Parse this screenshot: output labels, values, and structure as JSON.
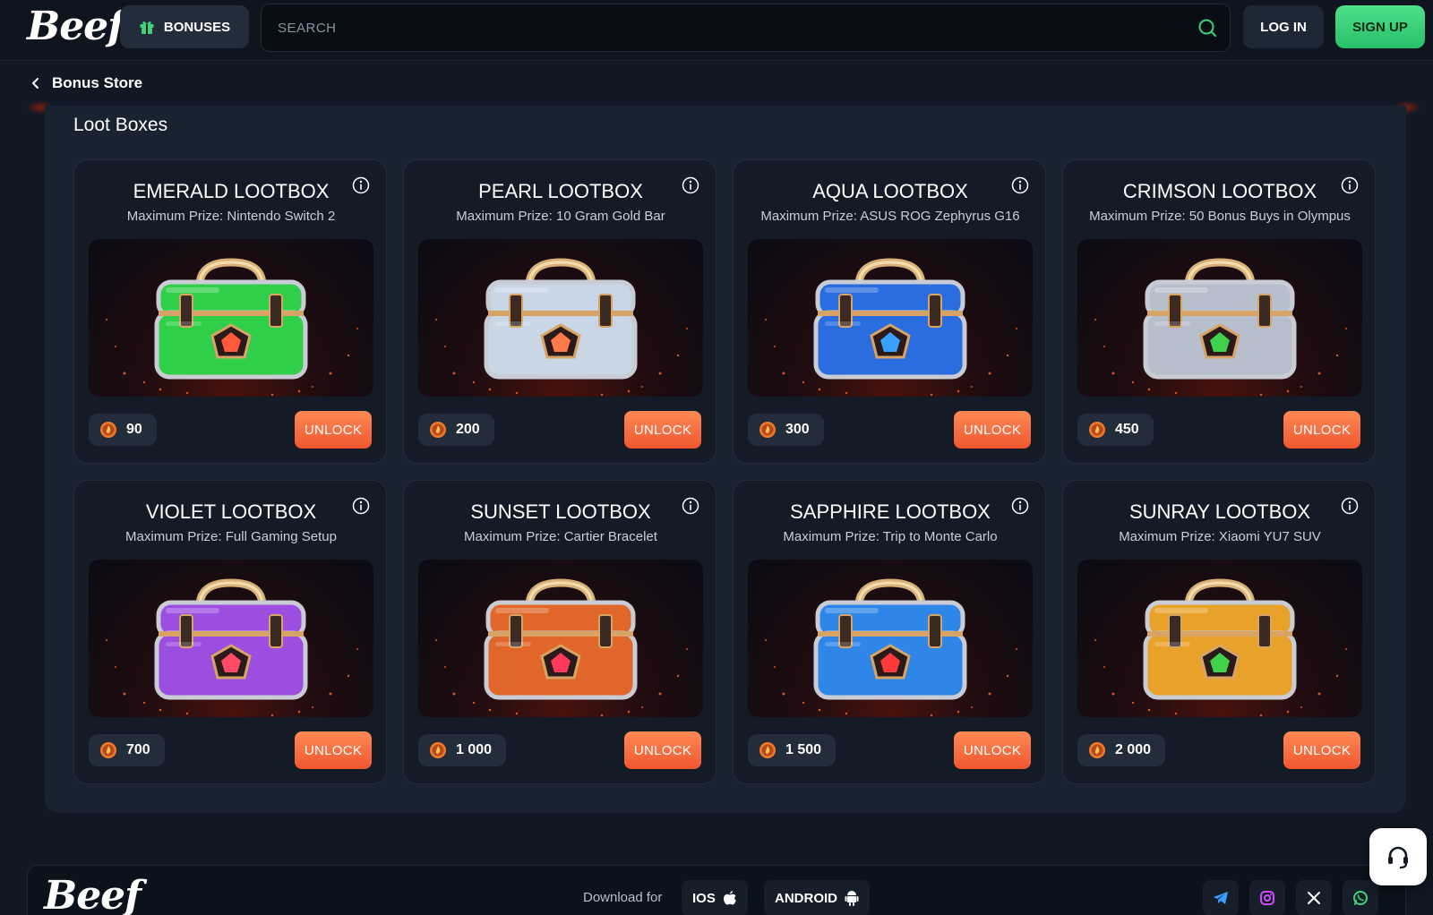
{
  "header": {
    "logo": "Beef",
    "bonuses_label": "BONUSES",
    "search_placeholder": "SEARCH",
    "login_label": "LOG IN",
    "signup_label": "SIGN UP"
  },
  "breadcrumb": {
    "label": "Bonus Store"
  },
  "section": {
    "title": "Loot Boxes"
  },
  "lootboxes": [
    {
      "name": "EMERALD LOOTBOX",
      "prize": "Maximum Prize: Nintendo Switch 2",
      "price": "90",
      "button": "UNLOCK",
      "color": "#2fcf4a",
      "gem": "#ff5a3a"
    },
    {
      "name": "PEARL LOOTBOX",
      "prize": "Maximum Prize: 10 Gram Gold Bar",
      "price": "200",
      "button": "UNLOCK",
      "color": "#c9d6e6",
      "gem": "#ff7a4a"
    },
    {
      "name": "AQUA LOOTBOX",
      "prize": "Maximum Prize: ASUS ROG Zephyrus G16",
      "price": "300",
      "button": "UNLOCK",
      "color": "#2a6de0",
      "gem": "#3aa0ff"
    },
    {
      "name": "CRIMSON LOOTBOX",
      "prize": "Maximum Prize: 50 Bonus Buys in Olympus",
      "price": "450",
      "button": "UNLOCK",
      "color": "#b8bfcc",
      "gem": "#3fd24a"
    },
    {
      "name": "VIOLET LOOTBOX",
      "prize": "Maximum Prize: Full Gaming Setup",
      "price": "700",
      "button": "UNLOCK",
      "color": "#9c4ee0",
      "gem": "#ff4a6a"
    },
    {
      "name": "SUNSET LOOTBOX",
      "prize": "Maximum Prize: Cartier Bracelet",
      "price": "1 000",
      "button": "UNLOCK",
      "color": "#e0662a",
      "gem": "#ff3a5a"
    },
    {
      "name": "SAPPHIRE LOOTBOX",
      "prize": "Maximum Prize: Trip to Monte Carlo",
      "price": "1 500",
      "button": "UNLOCK",
      "color": "#2e86e8",
      "gem": "#ff3a3a"
    },
    {
      "name": "SUNRAY LOOTBOX",
      "prize": "Maximum Prize: Xiaomi YU7 SUV",
      "price": "2 000",
      "button": "UNLOCK",
      "color": "#e8a22a",
      "gem": "#3fd24a"
    }
  ],
  "footer": {
    "logo": "Beef",
    "download_label": "Download for",
    "ios_label": "IOS",
    "android_label": "ANDROID"
  },
  "colors": {
    "accent_green": "#27c06a",
    "unlock_orange": "#f0562f",
    "background": "#111823"
  }
}
